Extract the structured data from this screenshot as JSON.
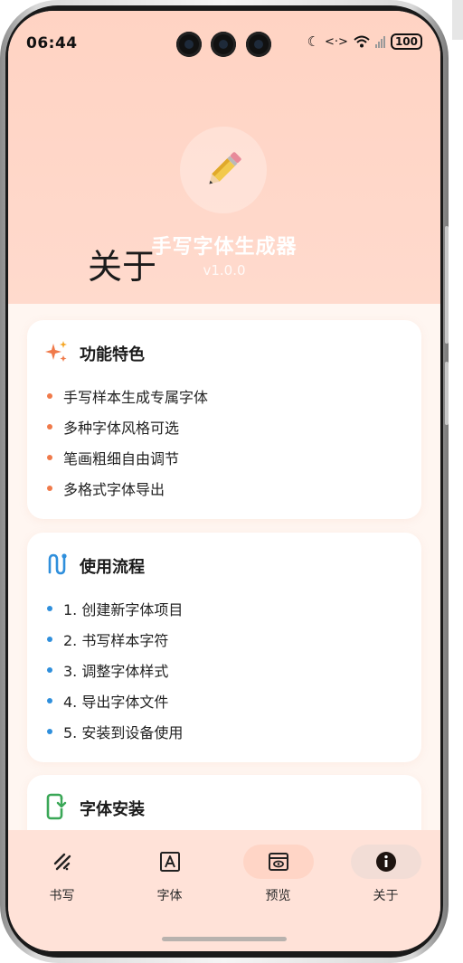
{
  "status_bar": {
    "time": "06:44",
    "battery": "100"
  },
  "header": {
    "page_title": "关于",
    "app_name": "手写字体生成器",
    "version": "v1.0.0",
    "logo_icon": "pencil-icon"
  },
  "cards": {
    "features": {
      "title": "功能特色",
      "icon": "sparkle-icon",
      "bullet_color": "#f07a4a",
      "items": [
        "手写样本生成专属字体",
        "多种字体风格可选",
        "笔画粗细自由调节",
        "多格式字体导出"
      ]
    },
    "workflow": {
      "title": "使用流程",
      "icon": "route-icon",
      "bullet_color": "#2f8fdc",
      "items": [
        "1. 创建新字体项目",
        "2. 书写样本字符",
        "3. 调整字体样式",
        "4. 导出字体文件",
        "5. 安装到设备使用"
      ]
    },
    "install": {
      "title": "字体安装",
      "icon": "phone-download-icon"
    }
  },
  "tabs": [
    {
      "label": "书写",
      "icon": "handwriting-icon",
      "selected": false
    },
    {
      "label": "字体",
      "icon": "font-box-icon",
      "selected": false
    },
    {
      "label": "预览",
      "icon": "preview-icon",
      "selected": false
    },
    {
      "label": "关于",
      "icon": "info-icon",
      "selected": true
    }
  ],
  "colors": {
    "header_bg": "#ffd3c3",
    "tabbar_bg": "#ffe2d8",
    "accent_orange": "#f07a4a",
    "accent_blue": "#2f8fdc",
    "accent_green": "#3aa757"
  }
}
